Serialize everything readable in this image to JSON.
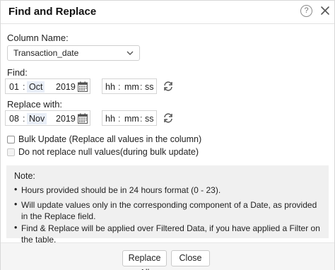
{
  "dialog": {
    "title": "Find and Replace",
    "help_glyph": "?"
  },
  "column": {
    "label": "Column Name:",
    "selected": "Transaction_date"
  },
  "find": {
    "label": "Find:",
    "day": "01",
    "month": "Oct",
    "year": "2019",
    "hh": "hh",
    "mm": "mm",
    "ss": "ss"
  },
  "replace": {
    "label": "Replace with:",
    "day": "08",
    "month": "Nov",
    "year": "2019",
    "hh": "hh",
    "mm": "mm",
    "ss": "ss"
  },
  "separators": {
    "colon": ":"
  },
  "options": {
    "bulk_update": {
      "label": "Bulk Update (Replace all values in the column)",
      "checked": false,
      "disabled": false
    },
    "skip_null": {
      "label": "Do not replace null values(during bulk update)",
      "checked": false,
      "disabled": true
    }
  },
  "note": {
    "title": "Note:",
    "bullet_glyph": "•",
    "items": [
      "Hours provided should be in 24 hours format (0 - 23).",
      "Will update values only in the corresponding component of a Date, as provided in the Replace field.",
      "Find & Replace will be applied over Filtered Data, if you have applied a Filter on the table."
    ]
  },
  "footer": {
    "replace_all_label": "Replace All",
    "close_label": "Close"
  },
  "icons": {
    "help": "help-circle-icon",
    "close": "close-icon",
    "dropdown": "chevron-down-icon",
    "calendar": "calendar-icon",
    "reset": "refresh-icon"
  },
  "colors": {
    "highlight_segment": "#e9eef7",
    "note_background": "#f0f0f0",
    "footer_background": "#f5f5f5"
  }
}
